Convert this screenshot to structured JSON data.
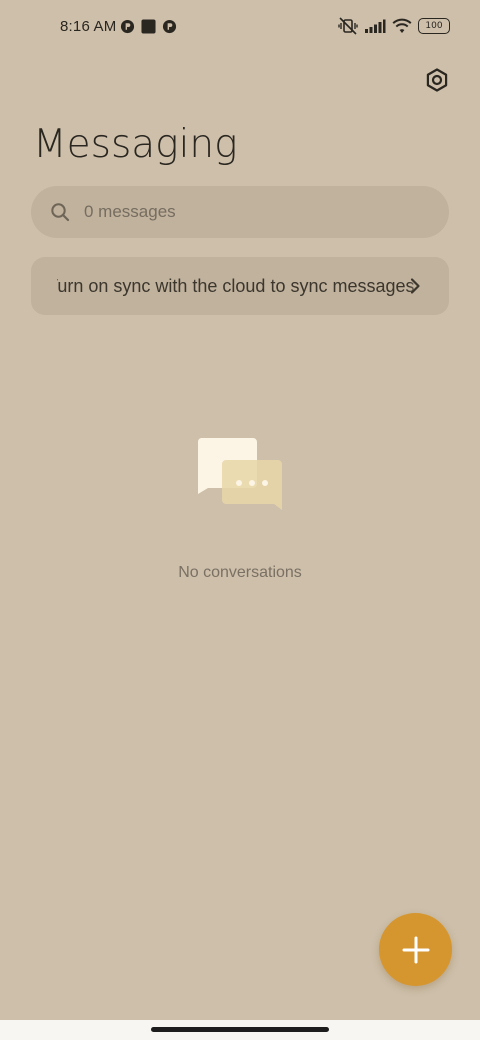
{
  "status_bar": {
    "time": "8:16 AM",
    "battery": "100"
  },
  "header": {
    "title": "Messaging"
  },
  "search": {
    "placeholder": "0 messages"
  },
  "sync_banner": {
    "text": "Turn on sync with the cloud to sync messages"
  },
  "empty_state": {
    "text": "No conversations"
  },
  "icons": {
    "settings": "settings-icon",
    "search": "search-icon",
    "chevron": "chevron-right-icon",
    "fab": "plus-icon"
  },
  "colors": {
    "background": "#cdbfaa",
    "surface": "#c0b29d",
    "accent": "#d6962f"
  }
}
